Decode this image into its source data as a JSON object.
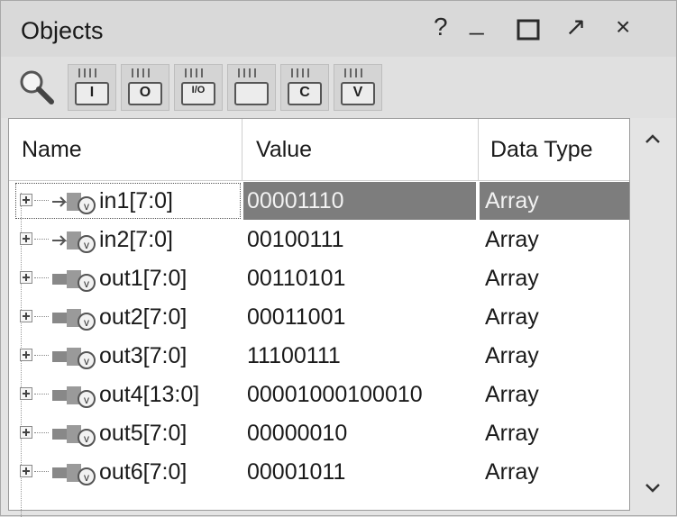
{
  "window": {
    "title": "Objects",
    "help_label": "?",
    "minimize_label": "_",
    "float_label": "↗",
    "close_label": "×"
  },
  "toolbar": {
    "buttons": [
      {
        "icon": "input-signal-icon",
        "label": "I"
      },
      {
        "icon": "output-signal-icon",
        "label": "O"
      },
      {
        "icon": "inout-signal-icon",
        "label": "I/O"
      },
      {
        "icon": "internal-signal-icon",
        "label": ""
      },
      {
        "icon": "constant-signal-icon",
        "label": "C"
      },
      {
        "icon": "variable-signal-icon",
        "label": "V"
      }
    ]
  },
  "table": {
    "columns": [
      "Name",
      "Value",
      "Data Type"
    ],
    "rows": [
      {
        "name": "in1[7:0]",
        "value": "00001110",
        "type": "Array",
        "kind": "input",
        "selected": true
      },
      {
        "name": "in2[7:0]",
        "value": "00100111",
        "type": "Array",
        "kind": "input",
        "selected": false
      },
      {
        "name": "out1[7:0]",
        "value": "00110101",
        "type": "Array",
        "kind": "output",
        "selected": false
      },
      {
        "name": "out2[7:0]",
        "value": "00011001",
        "type": "Array",
        "kind": "output",
        "selected": false
      },
      {
        "name": "out3[7:0]",
        "value": "11100111",
        "type": "Array",
        "kind": "output",
        "selected": false
      },
      {
        "name": "out4[13:0]",
        "value": "00001000100010",
        "type": "Array",
        "kind": "output",
        "selected": false
      },
      {
        "name": "out5[7:0]",
        "value": "00000010",
        "type": "Array",
        "kind": "output",
        "selected": false
      },
      {
        "name": "out6[7:0]",
        "value": "00001011",
        "type": "Array",
        "kind": "output",
        "selected": false
      }
    ]
  },
  "colors": {
    "selection": "#7d7d7d",
    "panel": "#e4e4e4"
  }
}
